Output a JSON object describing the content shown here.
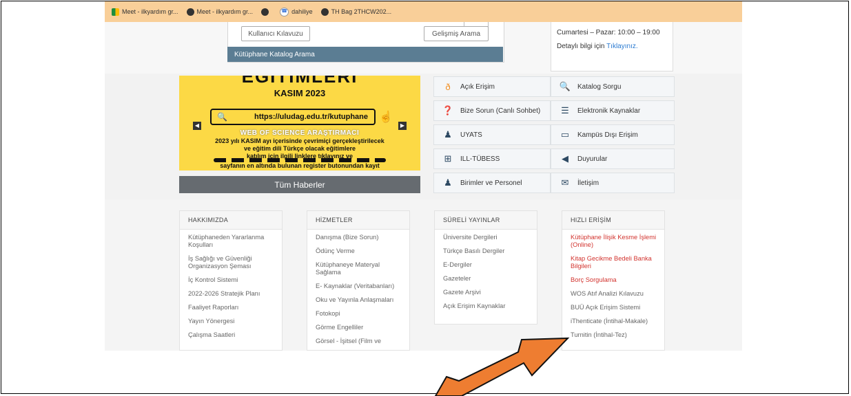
{
  "bookmarks": [
    {
      "icon": "meet-icon",
      "label": "Meet - ilkyardım gr..."
    },
    {
      "icon": "globe-icon",
      "label": "Meet - ilkyardım gr..."
    },
    {
      "icon": "globe-icon",
      "label": ""
    },
    {
      "icon": "phone-icon",
      "label": "dahiliye"
    },
    {
      "icon": "globe-icon",
      "label": "TH Bag 2THCW202..."
    }
  ],
  "catalog": {
    "user_guide": "Kullanıcı Kılavuzu",
    "advanced_search": "Gelişmiş Arama",
    "bar_title": "Kütüphane Katalog Arama"
  },
  "hours": {
    "weekend": "Cumartesi – Pazar: 10:00 – 19:00",
    "info_prefix": "Detaylı bilgi için ",
    "info_link": "Tıklayınız."
  },
  "banner": {
    "title": "EĞİTİMLERİ",
    "date": "KASIM 2023",
    "url": "https://uludag.edu.tr/kutuphane",
    "subtitle": "WEB OF SCIENCE ARAŞTIRMACI",
    "line1": "2023 yılı KASIM ayı içerisinde çevrimiçi gerçekleştirilecek",
    "line2": "ve eğitim dili Türkçe olacak eğitimlere",
    "line3": "katılım için ilgili linklere tıklayınız ve",
    "line4": "sayfanın en altında bulunan register butonundan kayıt"
  },
  "all_news": "Tüm Haberler",
  "quick_links": [
    {
      "icon": "open-access-icon",
      "label": "Açık Erişim"
    },
    {
      "icon": "catalog-search-icon",
      "label": "Katalog Sorgu"
    },
    {
      "icon": "question-icon",
      "label": "Bize Sorun (Canlı Sohbet)"
    },
    {
      "icon": "database-icon",
      "label": "Elektronik Kaynaklar"
    },
    {
      "icon": "users-icon",
      "label": "UYATS"
    },
    {
      "icon": "remote-access-icon",
      "label": "Kampüs Dışı Erişim"
    },
    {
      "icon": "network-icon",
      "label": "ILL-TÜBESS"
    },
    {
      "icon": "megaphone-icon",
      "label": "Duyurular"
    },
    {
      "icon": "staff-icon",
      "label": "Birimler ve Personel"
    },
    {
      "icon": "envelope-icon",
      "label": "İletişim"
    }
  ],
  "footer": {
    "about": {
      "title": "HAKKIMIZDA",
      "items": [
        "Kütüphaneden Yararlanma Koşulları",
        "İş Sağlığı ve Güvenliği Organizasyon Şeması",
        "İç Kontrol Sistemi",
        "2022-2026 Stratejik Planı",
        "Faaliyet Raporları",
        "Yayın Yönergesi",
        "Çalışma Saatleri"
      ]
    },
    "services": {
      "title": "HİZMETLER",
      "items": [
        "Danışma (Bize Sorun)",
        "Ödünç Verme",
        "Kütüphaneye Materyal Sağlama",
        "E- Kaynaklar (Veritabanları)",
        "Oku ve Yayınla Anlaşmaları",
        "Fotokopi",
        "Görme Engelliler",
        "Görsel - İşitsel (Film ve"
      ]
    },
    "periodicals": {
      "title": "SÜRELİ YAYINLAR",
      "items": [
        "Üniversite Dergileri",
        "Türkçe Basılı Dergiler",
        "E-Dergiler",
        "Gazeteler",
        "Gazete Arşivi",
        "Açık Erişim Kaynaklar"
      ]
    },
    "quick": {
      "title": "HIZLI ERİŞİM",
      "items": [
        "Kütüphane İlişik Kesme İşlemi (Online)",
        "Kitap Gecikme Bedeli Banka Bilgileri",
        "Borç Sorgulama",
        "WOS Atıf Analizi Kılavuzu",
        "BUÜ Açık Erişim Sistemi",
        "iThenticate (İntihal-Makale)",
        "Turnitin (İntihal-Tez)"
      ]
    }
  },
  "colors": {
    "bookmark_bar": "#f9cf99",
    "catalog_bar": "#5b7d93",
    "banner_bg": "#fcd945",
    "link_red": "#d2332e",
    "arrow": "#ee7d31"
  }
}
